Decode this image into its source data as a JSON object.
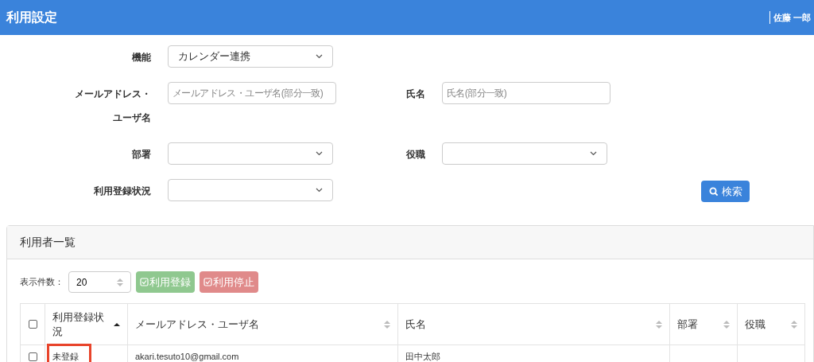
{
  "header": {
    "title": "利用設定",
    "user": "佐藤 一郎"
  },
  "filters": [
    {
      "kind": "select",
      "label": "機能",
      "value": "カレンダー連携"
    },
    {
      "kind": "input",
      "label_lines": [
        "メールアドレス・",
        "ユーザ名"
      ],
      "placeholder": "メールアドレス・ユーザ名(部分一致)"
    },
    {
      "kind": "input",
      "label": "氏名",
      "placeholder": "氏名(部分一致)"
    },
    {
      "kind": "select",
      "label": "部署"
    },
    {
      "kind": "select",
      "label": "役職"
    },
    {
      "kind": "select",
      "label": "利用登録状況"
    }
  ],
  "search_button": "検索",
  "panel": {
    "title": "利用者一覧",
    "page_size_label": "表示件数：",
    "page_size": "20",
    "actions": [
      {
        "label": "利用登録",
        "color": "#8fc88f"
      },
      {
        "label": "利用停止",
        "color": "#e08a8a"
      }
    ]
  },
  "table": {
    "columns": [
      {
        "label": "利用登録状況",
        "sorted": true
      },
      {
        "label": "メールアドレス・ユーザ名",
        "sorted": false
      },
      {
        "label": "氏名",
        "sorted": false
      },
      {
        "label": "部署",
        "sorted": false
      },
      {
        "label": "役職",
        "sorted": false
      }
    ],
    "rows": [
      {
        "checked": false,
        "highlighted": true,
        "cells": [
          "未登録",
          "akari.tesuto10@gmail.com",
          "田中太郎",
          "",
          ""
        ]
      }
    ]
  },
  "select_all_checked": false
}
